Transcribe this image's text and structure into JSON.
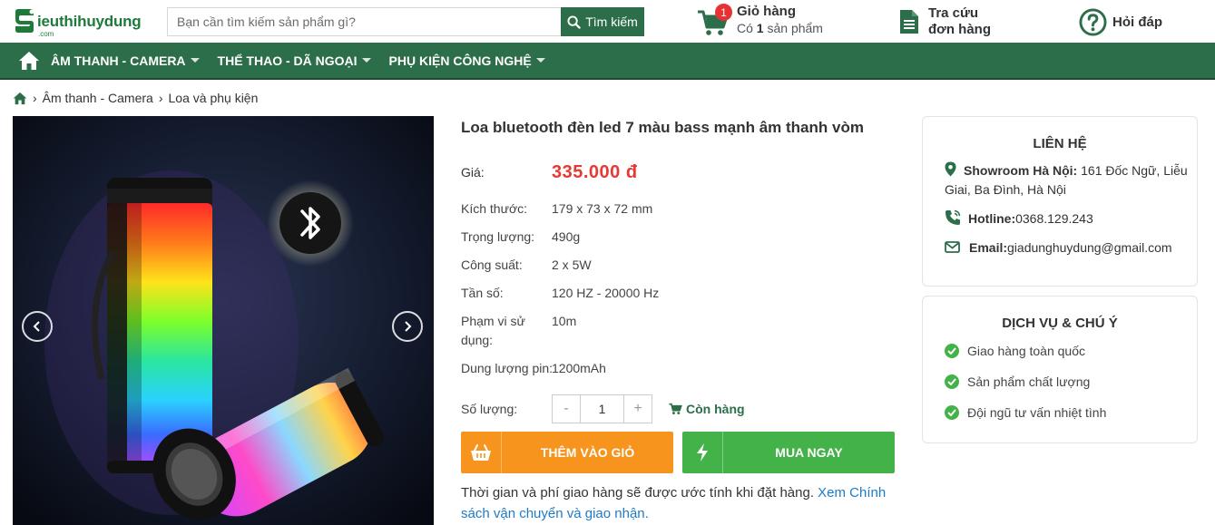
{
  "header": {
    "logo_text": "ieuthihuydung",
    "logo_sub": ".com",
    "search_placeholder": "Bạn cần tìm kiếm sản phẩm gì?",
    "search_button": "Tìm kiếm",
    "cart": {
      "count": "1",
      "title": "Giỏ hàng",
      "sub_prefix": "Có ",
      "sub_count": "1",
      "sub_suffix": " sản phẩm"
    },
    "tracking": {
      "line1": "Tra cứu",
      "line2": "đơn hàng"
    },
    "faq": "Hỏi đáp"
  },
  "nav": {
    "items": [
      {
        "label": "ÂM THANH - CAMERA"
      },
      {
        "label": "THỂ THAO - DÃ NGOẠI"
      },
      {
        "label": "PHỤ KIỆN CÔNG NGHỆ"
      }
    ]
  },
  "breadcrumb": {
    "items": [
      "Âm thanh - Camera",
      "Loa và phụ kiện"
    ]
  },
  "product": {
    "title": "Loa bluetooth đèn led 7 màu bass mạnh âm thanh vòm",
    "price_label": "Giá:",
    "price": "335.000 đ",
    "specs": [
      {
        "label": "Kích thước:",
        "value": "179 x 73 x 72 mm"
      },
      {
        "label": "Trọng lượng:",
        "value": "490g"
      },
      {
        "label": "Công suất:",
        "value": "2 x 5W"
      },
      {
        "label": "Tần số:",
        "value": "120 HZ - 20000 Hz"
      },
      {
        "label": "Phạm vi sử dụng:",
        "value": "10m"
      },
      {
        "label": "Dung lượng pin:",
        "value": "1200mAh"
      }
    ],
    "quantity_label": "Số lượng:",
    "quantity": "1",
    "minus": "-",
    "plus": "+",
    "stock": "Còn hàng",
    "add_to_cart": "THÊM VÀO GIỎ",
    "buy_now": "MUA NGAY",
    "shipping_note": "Thời gian và phí giao hàng sẽ được ước tính khi đặt hàng. ",
    "shipping_link": "Xem Chính sách vận chuyển và giao nhận."
  },
  "contact": {
    "title": "LIÊN HỆ",
    "showroom_label": "Showroom Hà Nội:",
    "showroom_value": " 161 Đốc Ngữ, Liễu Giai, Ba Đình, Hà Nội",
    "hotline_label": "Hotline:",
    "hotline_value": "0368.129.243",
    "email_label": "Email:",
    "email_value": "giadunghuydung@gmail.com"
  },
  "services": {
    "title": "DỊCH VỤ & CHÚ Ý",
    "items": [
      "Giao hàng toàn quốc",
      "Sản phẩm chất lượng",
      "Đội ngũ tư vấn nhiệt tình"
    ]
  },
  "colors": {
    "brand_green": "#2c6e49",
    "price_red": "#e53935",
    "cart_orange": "#f7941d",
    "buy_green": "#43b349",
    "link_blue": "#1e7bc7"
  }
}
